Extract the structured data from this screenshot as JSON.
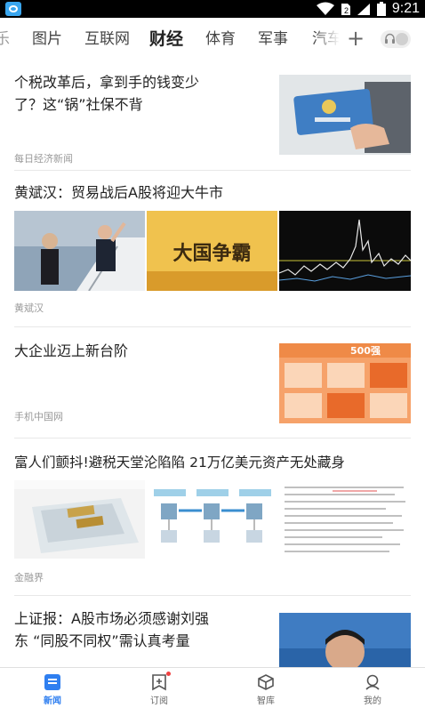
{
  "status_bar": {
    "time": "9:21",
    "icons": [
      "app-icon",
      "wifi-icon",
      "sim-icon",
      "signal-icon",
      "battery-icon"
    ]
  },
  "tabs": {
    "items": [
      {
        "label": "乐",
        "active": false,
        "clipped": true
      },
      {
        "label": "图片",
        "active": false
      },
      {
        "label": "互联网",
        "active": false
      },
      {
        "label": "财经",
        "active": true
      },
      {
        "label": "体育",
        "active": false
      },
      {
        "label": "军事",
        "active": false
      },
      {
        "label": "汽车",
        "active": false,
        "clipped": true
      }
    ],
    "add_label": "+",
    "icons": [
      "plus-icon",
      "headset-icon"
    ]
  },
  "feed": {
    "items": [
      {
        "title": "个税改革后，拿到手的钱变少了？这“锅”社保不背",
        "source": "每日经济新闻",
        "layout": "right-thumb",
        "image": "hand-holding-card-thumbnail"
      },
      {
        "title": "黄斌汉：贸易战后A股将迎大牛市",
        "source": "黄斌汉",
        "layout": "three-thumbs",
        "images": [
          "couple-at-plane-stairs-thumbnail",
          "gold-banner-thumbnail",
          "stock-chart-thumbnail"
        ],
        "banner_text": "大国争霸"
      },
      {
        "title": "大企业迈上新台阶",
        "source": "手机中国网",
        "layout": "right-thumb",
        "image": "orange-infographic-thumbnail",
        "thumb_text": "500强"
      },
      {
        "title": "富人们颤抖!避税天堂沦陷陷 21万亿美元资产无处藏身",
        "source": "金融界",
        "layout": "three-thumbs",
        "images": [
          "gold-bars-thumbnail",
          "flow-diagram-thumbnail",
          "document-text-thumbnail"
        ]
      },
      {
        "title": "上证报：A股市场必须感谢刘强东 “同股不同权”需认真考量",
        "source": "",
        "layout": "right-thumb",
        "image": "businessman-portrait-thumbnail"
      }
    ]
  },
  "bottom_nav": {
    "items": [
      {
        "label": "新闻",
        "icon": "news-icon",
        "active": true
      },
      {
        "label": "订阅",
        "icon": "subscribe-icon",
        "active": false,
        "badge": true
      },
      {
        "label": "智库",
        "icon": "cube-icon",
        "active": false
      },
      {
        "label": "我的",
        "icon": "profile-icon",
        "active": false
      }
    ]
  },
  "colors": {
    "accent": "#2f7ff0",
    "badge": "#f04040",
    "text": "#222222",
    "secondary_text": "#9a9a9a",
    "divider": "#e8e8e8"
  }
}
